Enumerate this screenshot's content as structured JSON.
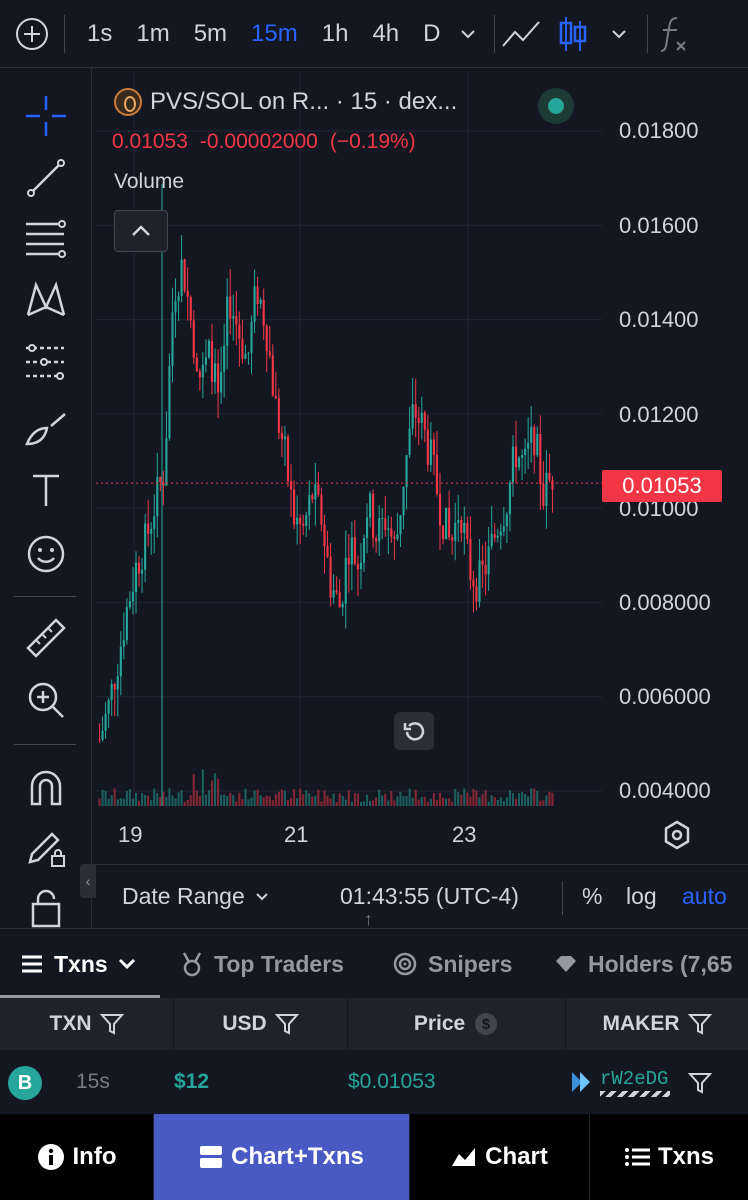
{
  "toolbar": {
    "timeframes": [
      "1s",
      "1m",
      "5m",
      "15m",
      "1h",
      "4h",
      "D"
    ],
    "active_timeframe": "15m"
  },
  "legend": {
    "symbol_title": "PVS/SOL on R... · 15 · dex...",
    "last": "0.01053",
    "change": "-0.00002000",
    "change_pct": "(−0.19%)",
    "volume_label": "Volume"
  },
  "price_axis": {
    "ticks": [
      "0.01800",
      "0.01600",
      "0.01400",
      "0.01200",
      "0.01000",
      "0.008000",
      "0.006000",
      "0.004000"
    ],
    "last_price_label": "0.01053"
  },
  "date_axis": {
    "ticks": [
      "19",
      "21",
      "23"
    ]
  },
  "chart_data": {
    "type": "candlestick",
    "ylim": [
      0.004,
      0.018
    ],
    "last_price": 0.01053,
    "x_ticks": [
      "19",
      "21",
      "23"
    ],
    "close_series": [
      0.0051,
      0.0058,
      0.0068,
      0.0079,
      0.0088,
      0.0093,
      0.0101,
      0.0108,
      0.0146,
      0.0152,
      0.0138,
      0.0127,
      0.0133,
      0.0121,
      0.0145,
      0.0138,
      0.0131,
      0.0147,
      0.0139,
      0.0122,
      0.0112,
      0.0098,
      0.0095,
      0.0103,
      0.0098,
      0.0084,
      0.0079,
      0.0093,
      0.0088,
      0.0101,
      0.0094,
      0.0098,
      0.0091,
      0.0108,
      0.0121,
      0.0117,
      0.0109,
      0.0099,
      0.0092,
      0.0101,
      0.0087,
      0.0084,
      0.0089,
      0.0096,
      0.0101,
      0.0112,
      0.0109,
      0.0116,
      0.0103,
      0.0107
    ]
  },
  "datebar": {
    "date_range": "Date Range",
    "clock": "01:43:55 (UTC-4)",
    "percent": "%",
    "log": "log",
    "auto": "auto"
  },
  "tabs": {
    "txns": "Txns",
    "top_traders": "Top Traders",
    "snipers": "Snipers",
    "holders": "Holders (7,65"
  },
  "table": {
    "headers": [
      "TXN",
      "USD",
      "Price",
      "MAKER"
    ],
    "rows": [
      {
        "type": "B",
        "age": "15s",
        "usd": "$12",
        "price": "$0.01053",
        "maker": "rW2eDG"
      }
    ]
  },
  "colors": {
    "up": "#26a69a",
    "down": "#f23645",
    "accent": "#2962ff",
    "active_nav": "#4a5ac4"
  },
  "bottom_nav": {
    "info": "Info",
    "chart_txns": "Chart+Txns",
    "chart": "Chart",
    "txns": "Txns"
  }
}
